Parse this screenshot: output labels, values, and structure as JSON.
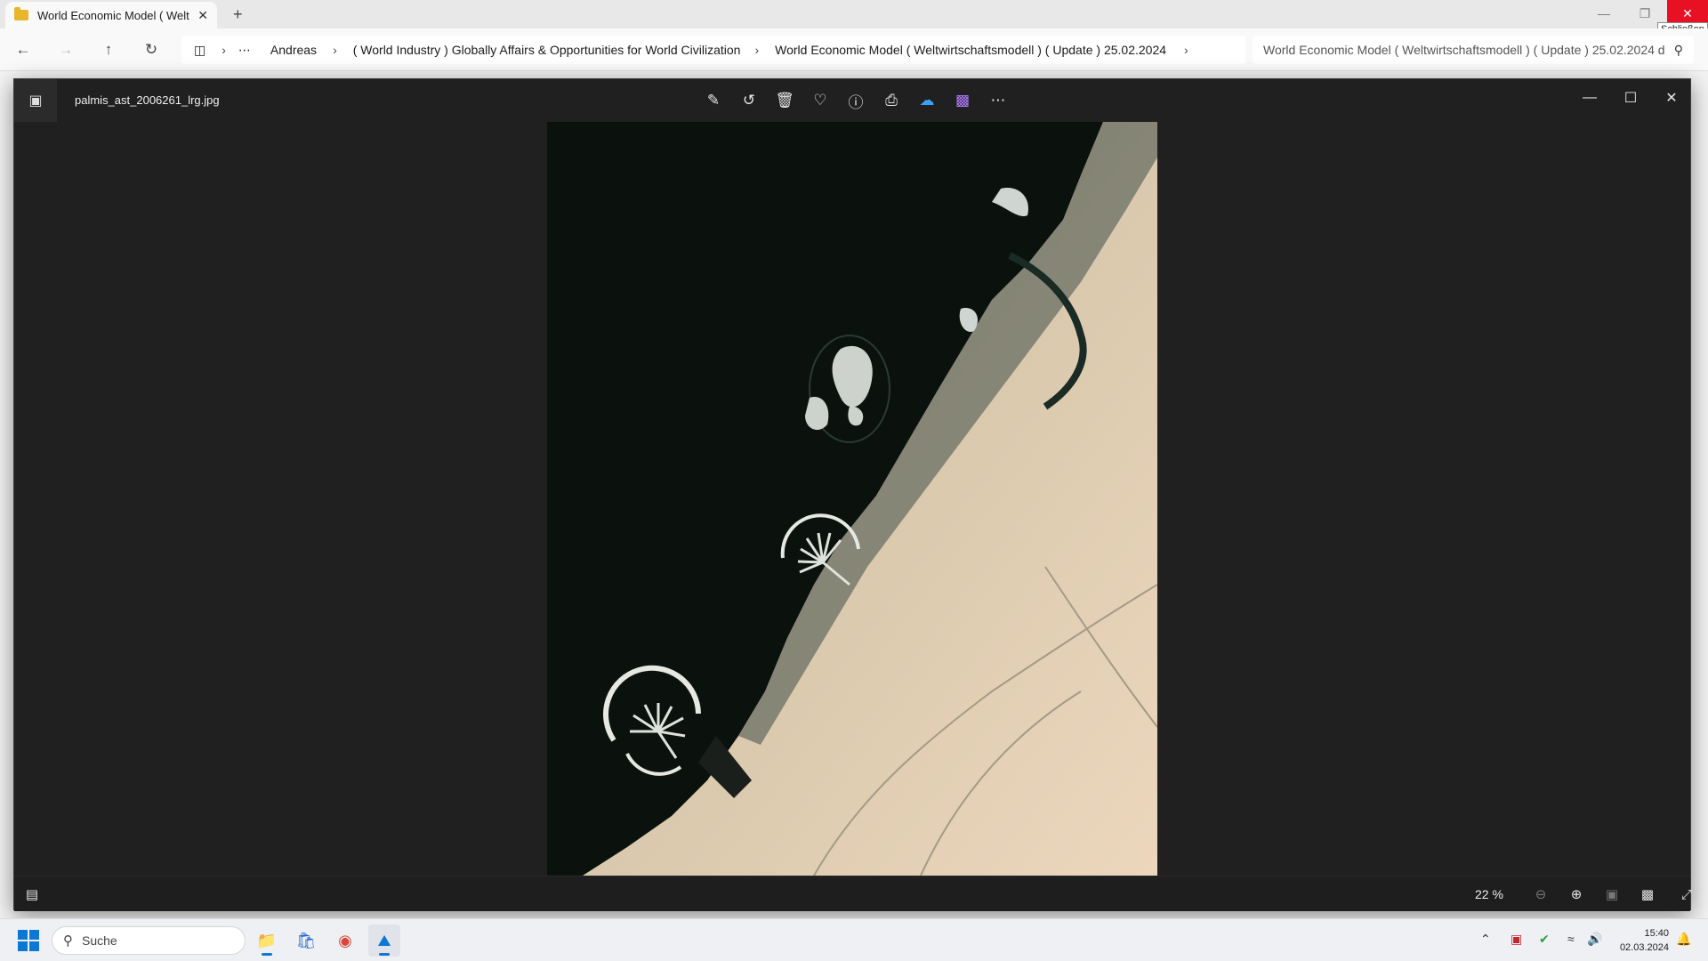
{
  "explorer": {
    "tab_title": "World Economic Model ( Welt",
    "tab_close": "✕",
    "new_tab": "+",
    "close_tooltip": "Schließen",
    "breadcrumbs": [
      "Andreas",
      "( World Industry ) Globally Affairs & Opportunities for World Civilization",
      "World Economic Model ( Weltwirtschaftsmodell ) ( Update ) 25.02.2024"
    ],
    "search_placeholder": "World Economic Model ( Weltwirtschaftsmodell ) ( Update ) 25.02.2024 d"
  },
  "viewer": {
    "file_name": "palmis_ast_2006261_lrg.jpg",
    "zoom": "22 %",
    "toolbar_icons": [
      "edit-icon",
      "rotate-icon",
      "delete-icon",
      "favorite-icon",
      "info-icon",
      "print-icon",
      "onedrive-icon",
      "clipchamp-icon",
      "more-icon"
    ]
  },
  "taskbar": {
    "search_label": "Suche",
    "time": "15:40",
    "date": "02.03.2024"
  },
  "colors": {
    "close_red": "#e81123",
    "viewer_bg": "#202020",
    "accent": "#0a78d4"
  }
}
